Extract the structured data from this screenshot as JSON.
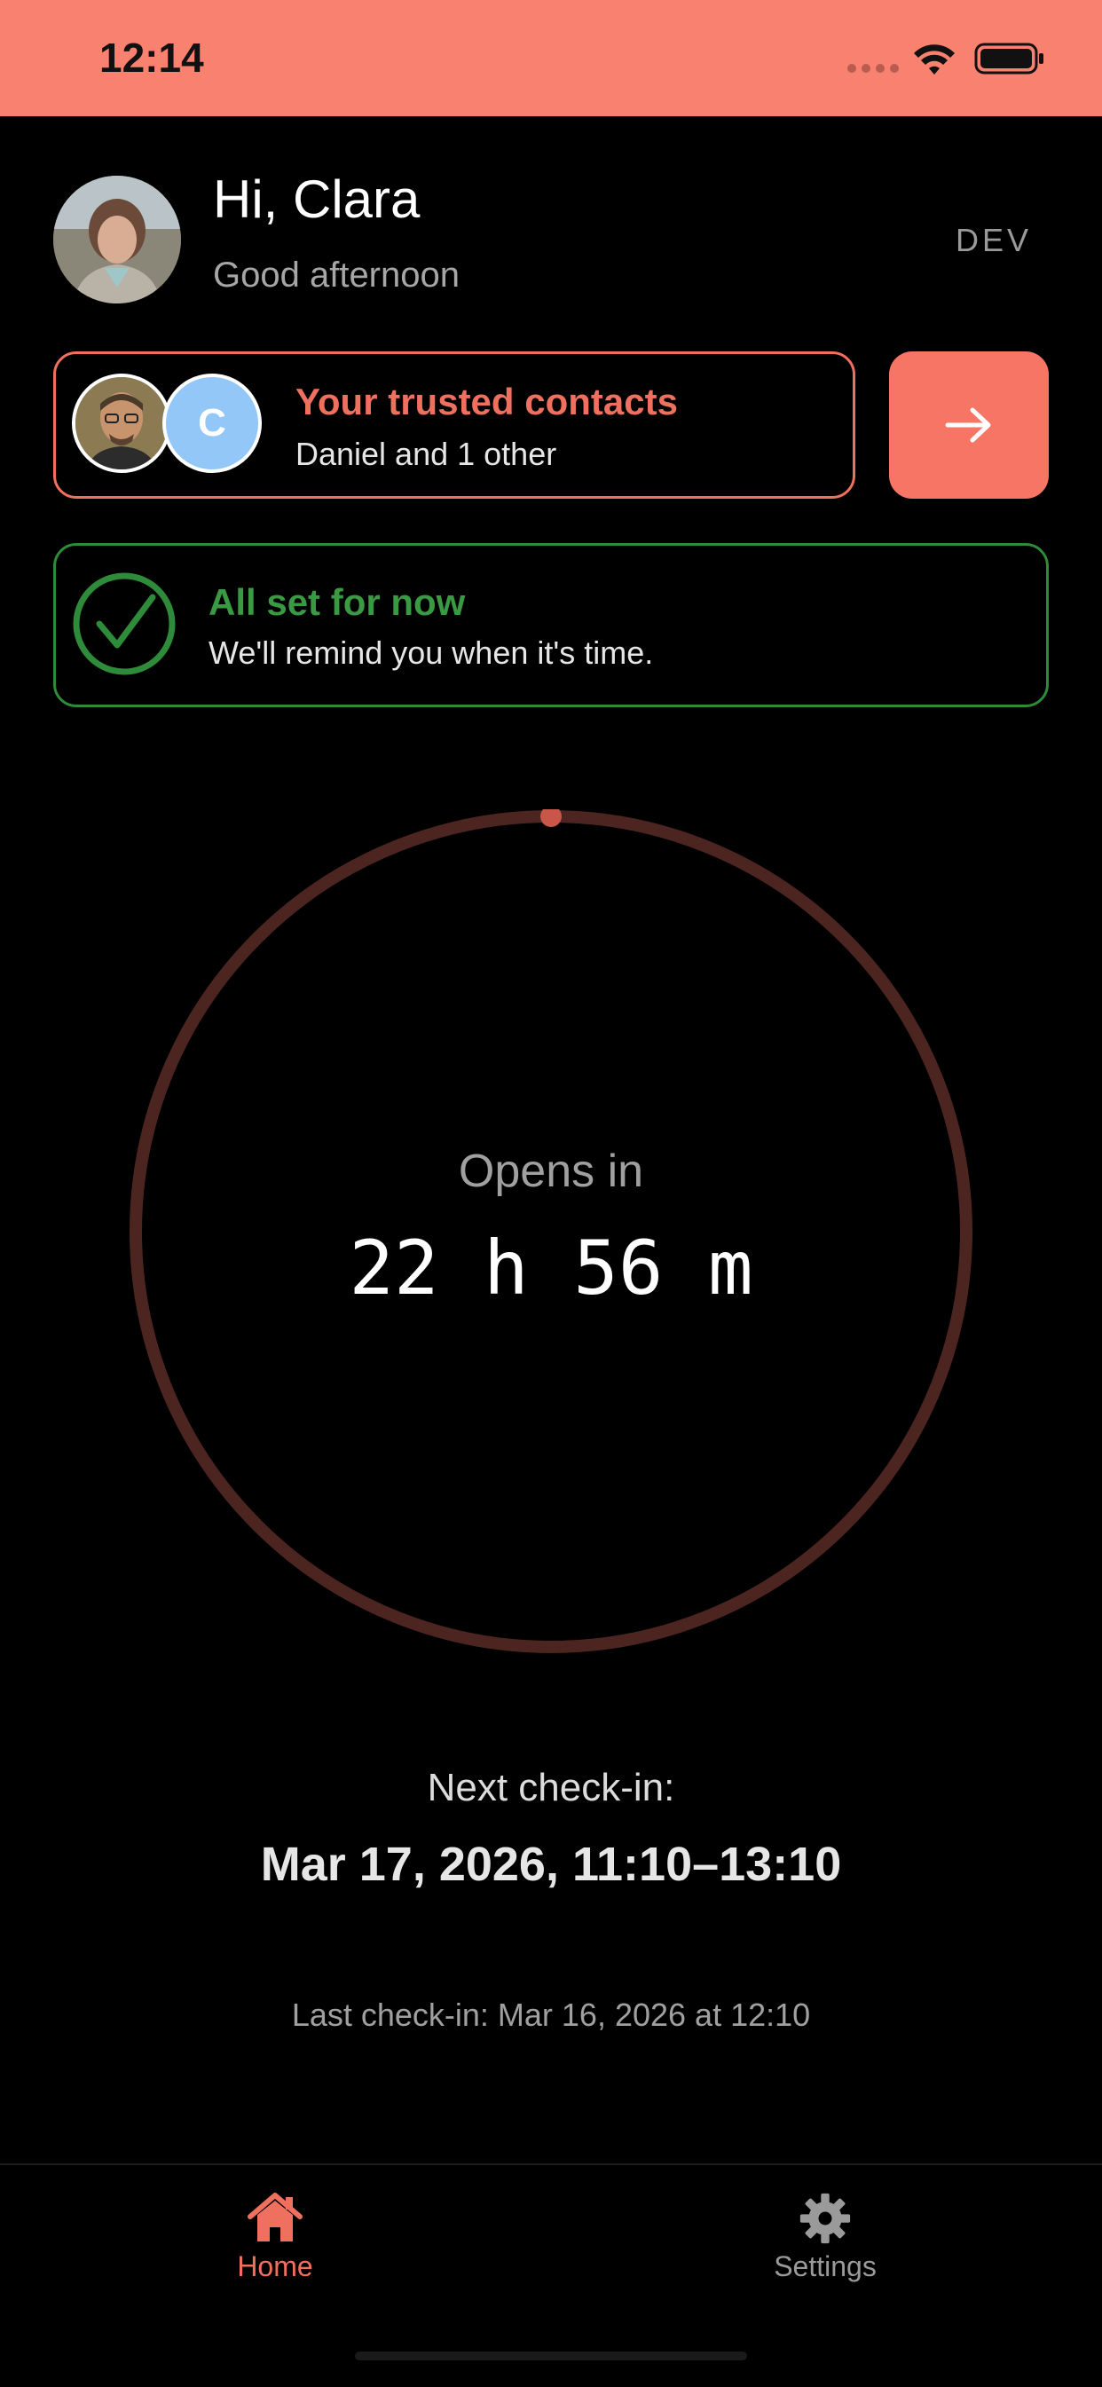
{
  "status_bar": {
    "time": "12:14",
    "background": "#F9816F"
  },
  "header": {
    "greeting": "Hi, Clara",
    "subtitle": "Good afternoon",
    "env_badge": "DEV"
  },
  "trusted_contacts": {
    "title": "Your trusted contacts",
    "subtitle": "Daniel and 1 other",
    "second_avatar_initial": "C",
    "accent": "#F0705F",
    "action_icon": "arrow-right-icon"
  },
  "status_card": {
    "title": "All set for now",
    "message": "We'll remind you when it's time.",
    "accent": "#2E8B3A",
    "icon": "check-circle-icon"
  },
  "timer": {
    "label": "Opens in",
    "countdown": "22 h 56 m",
    "progress": 0.0
  },
  "next_checkin": {
    "label": "Next check-in:",
    "value": "Mar 17, 2026, 11:10–13:10"
  },
  "last_checkin": "Last check-in: Mar 16, 2026 at 12:10",
  "tabs": [
    {
      "label": "Home",
      "icon": "home-icon",
      "active": true
    },
    {
      "label": "Settings",
      "icon": "gear-icon",
      "active": false
    }
  ]
}
